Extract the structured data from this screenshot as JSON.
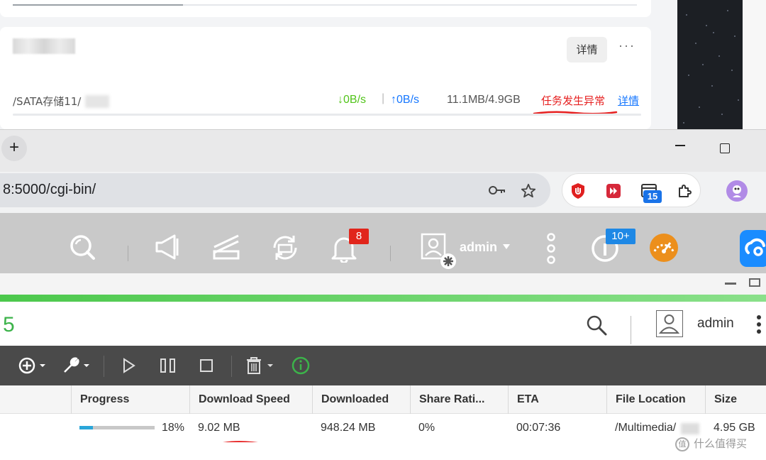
{
  "task_list": {
    "detail_button": "详情",
    "more": "···",
    "path": "/SATA存储11/",
    "download_speed": "↓0B/s",
    "separator": "|",
    "upload_speed": "↑0B/s",
    "size": "11.1MB/4.9GB",
    "error_text": "任务发生异常",
    "error_link": "详情"
  },
  "browser": {
    "new_tab": "+",
    "url": "8:5000/cgi-bin/",
    "extension_badge": "15"
  },
  "nas_toolbar": {
    "notification_count": "8",
    "user": "admin",
    "update_badge": "10+"
  },
  "download_station": {
    "header_number": "5",
    "user": "admin",
    "columns": [
      "Progress",
      "Download Speed",
      "Downloaded",
      "Share Rati...",
      "ETA",
      "File Location",
      "Size"
    ],
    "row": {
      "progress_value": 0.18,
      "progress": "18%",
      "download_speed": "9.02 MB",
      "downloaded": "948.24 MB",
      "share_ratio": "0%",
      "eta": "00:07:36",
      "file_location": "/Multimedia/",
      "size": "4.95 GB"
    }
  },
  "watermark": {
    "logo": "值",
    "text": "什么值得买"
  },
  "colors": {
    "error": "#e62020",
    "download_green": "#52c41a",
    "upload_blue": "#1677ff",
    "progress_fill": "#2aa6d9",
    "accent_green": "#3cb34a",
    "notification_red": "#e1251b",
    "update_blue": "#1e88e5"
  }
}
